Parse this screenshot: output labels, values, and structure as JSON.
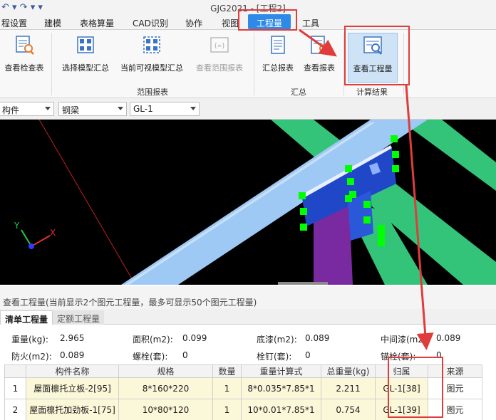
{
  "window": {
    "title": "GJG2021 - [工程2]",
    "quick_access": "↶ ▾ ↷ ▾ ▾"
  },
  "menu": {
    "items": [
      "程设置",
      "建模",
      "表格算量",
      "CAD识别",
      "协作",
      "视图",
      "工程量",
      "工具"
    ],
    "active": "工程量"
  },
  "ribbon": {
    "buttons": [
      {
        "label": "查看检查表",
        "icon": "search-table-icon",
        "enabled": true
      },
      {
        "label": "选择模型汇总",
        "icon": "grid-select-icon",
        "enabled": true
      },
      {
        "label": "当前可视模型汇总",
        "icon": "grid-visible-icon",
        "enabled": true
      },
      {
        "label": "查看范围报表",
        "icon": "range-report-icon",
        "enabled": false
      },
      {
        "label": "汇总报表",
        "icon": "report-icon",
        "enabled": true
      },
      {
        "label": "查看报表",
        "icon": "view-report-icon",
        "enabled": true
      },
      {
        "label": "查看工程量",
        "icon": "view-quantity-icon",
        "enabled": true
      }
    ],
    "groups": [
      "范围报表",
      "汇总",
      "计算结果"
    ]
  },
  "filters": {
    "category": "构件",
    "type": "钢梁",
    "element": "GL-1"
  },
  "viewport": {
    "axis_y": "Y",
    "axis_x": "X",
    "colors": {
      "background": "#000000",
      "beam_light": "#9ec9f5",
      "beam_green": "#33c47a",
      "part_blue": "#1f47c8",
      "part_purple": "#7a2aa0",
      "grip": "#00ff00"
    }
  },
  "panel": {
    "title": "查看工程量(当前显示2个图元工程量，最多可显示50个图元工程量)",
    "tabs": [
      "清单工程量",
      "定额工程量"
    ],
    "active_tab": "清单工程量"
  },
  "summary": {
    "row1": [
      {
        "label": "重量(kg):",
        "value": "2.965"
      },
      {
        "label": "面积(m2):",
        "value": "0.099"
      },
      {
        "label": "底漆(m2):",
        "value": "0.089"
      },
      {
        "label": "中间漆(m2):",
        "value": "0.089"
      }
    ],
    "row2": [
      {
        "label": "防火(m2):",
        "value": "0.089"
      },
      {
        "label": "螺栓(套):",
        "value": "0"
      },
      {
        "label": "栓钉(套):",
        "value": "0"
      },
      {
        "label": "锚栓(套):",
        "value": "0"
      }
    ]
  },
  "table": {
    "columns": [
      "",
      "构件名称",
      "规格",
      "数量",
      "重量计算式",
      "总重量(kg)",
      "归属",
      "来源"
    ],
    "rows": [
      [
        "1",
        "屋面檩托立板-2[95]",
        "8*160*220",
        "1",
        "8*0.035*7.85*1",
        "2.211",
        "GL-1[38]",
        "图元"
      ],
      [
        "2",
        "屋面檩托加劲板-1[75]",
        "10*80*120",
        "1",
        "10*0.01*7.85*1",
        "0.754",
        "GL-1[39]",
        "图元"
      ]
    ]
  },
  "colors": {
    "accent": "#2e8ae6",
    "annotation": "#e03c3c",
    "row_highlight": "#fbf7d9"
  }
}
